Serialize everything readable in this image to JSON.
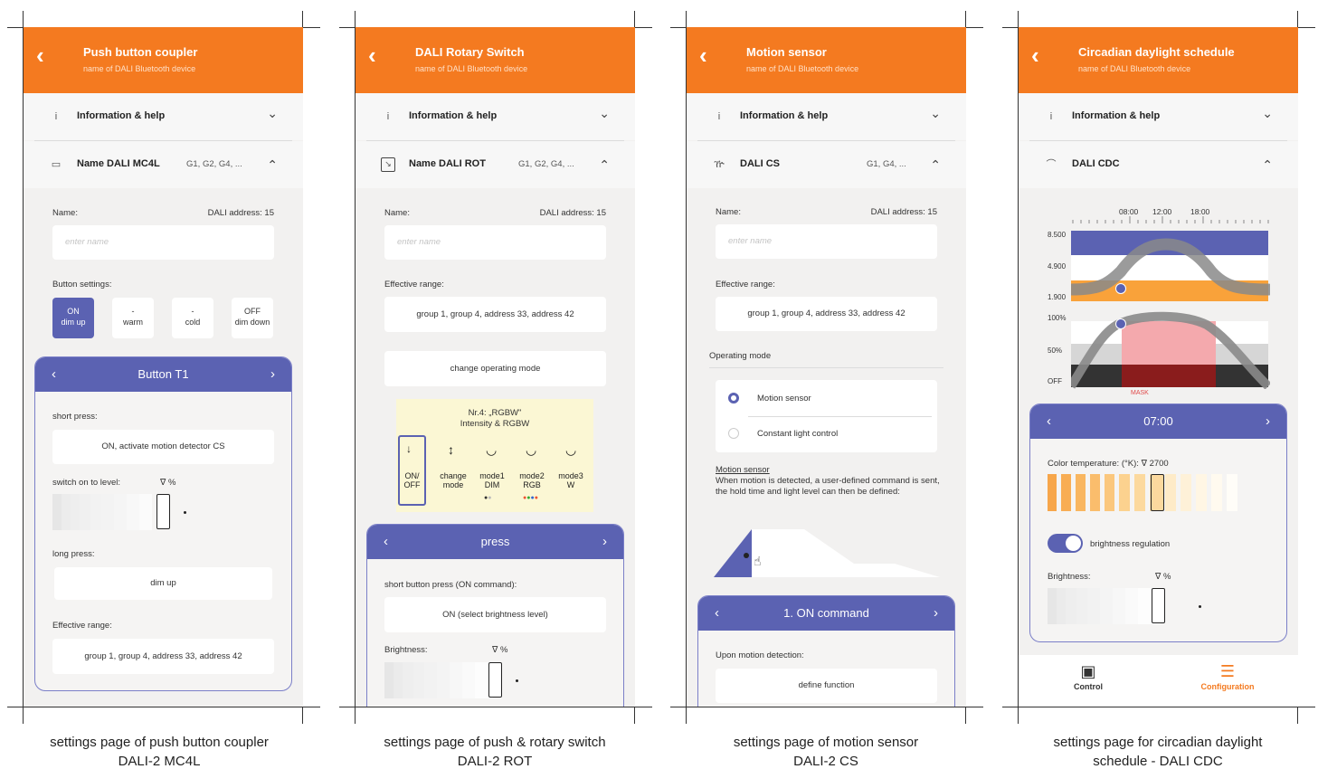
{
  "screens": [
    {
      "header": {
        "title": "Push button coupler",
        "subtitle": "name of DALI Bluetooth device"
      },
      "info": {
        "label": "Information & help"
      },
      "device": {
        "name": "Name DALI MC4L",
        "groups": "G1, G2, G4, ..."
      },
      "name_label": "Name:",
      "address": "DALI address: 15",
      "name_placeholder": "enter name",
      "button_settings_label": "Button settings:",
      "buttons": [
        {
          "top": "ON",
          "bottom": "dim up"
        },
        {
          "top": "-",
          "bottom": "warm"
        },
        {
          "top": "-",
          "bottom": "cold"
        },
        {
          "top": "OFF",
          "bottom": "dim down"
        }
      ],
      "panel_title": "Button T1",
      "short_press_label": "short press:",
      "short_press_value": "ON, activate motion detector CS",
      "switch_level_label": "switch on to level:",
      "switch_level_unit": "∇  %",
      "long_press_label": "long press:",
      "long_press_value": "dim up",
      "range_label": "Effective range:",
      "range_value": "group 1, group 4, address 33, address 42",
      "caption": "settings page of push button coupler\nDALI-2 MC4L"
    },
    {
      "header": {
        "title": "DALI Rotary Switch",
        "subtitle": "name of DALI Bluetooth device"
      },
      "info": {
        "label": "Information & help"
      },
      "device": {
        "name": "Name DALI ROT",
        "groups": "G1, G2, G4, ..."
      },
      "name_label": "Name:",
      "address": "DALI address: 15",
      "name_placeholder": "enter name",
      "range_label": "Effective range:",
      "range_value": "group 1, group 4, address 33, address 42",
      "change_mode": "change operating mode",
      "mode_box_title": "Nr.4: „RGBW\"\nIntensity & RGBW",
      "modes": [
        "ON/\nOFF",
        "change\nmode",
        "mode1\nDIM",
        "mode2\nRGB",
        "mode3\nW"
      ],
      "panel_title": "press",
      "short_btn_label": "short button press (ON command):",
      "short_btn_value": "ON (select brightness level)",
      "brightness_label": "Brightness:",
      "brightness_unit": "∇  %",
      "caption": "settings page of push & rotary switch\nDALI-2 ROT"
    },
    {
      "header": {
        "title": "Motion sensor",
        "subtitle": "name of DALI Bluetooth device"
      },
      "info": {
        "label": "Information & help"
      },
      "device": {
        "name": "DALI CS",
        "groups": "G1, G4, ..."
      },
      "name_label": "Name:",
      "address": "DALI address: 15",
      "name_placeholder": "enter name",
      "range_label": "Effective range:",
      "range_value": "group 1, group 4, address 33, address 42",
      "mode_label": "Operating mode",
      "options": [
        "Motion sensor",
        "Constant light control"
      ],
      "motion_title": "Motion sensor",
      "motion_text": "When motion is detected, a user-defined command is sent, the hold time and light level can then be defined:",
      "panel_title": "1. ON command",
      "upon_label": "Upon motion detection:",
      "define_value": "define function",
      "caption": "settings page of motion sensor\nDALI-2 CS"
    },
    {
      "header": {
        "title": "Circadian daylight schedule",
        "subtitle": "name of DALI Bluetooth device"
      },
      "info": {
        "label": "Information & help"
      },
      "device": {
        "name": "DALI CDC"
      },
      "times": [
        "08:00",
        "12:00",
        "18:00"
      ],
      "kelvin_labels": [
        "8.500",
        "4.900",
        "1.900"
      ],
      "level_labels": [
        "100%",
        "50%",
        "OFF"
      ],
      "mask_label": "MASK",
      "panel_title": "07:00",
      "color_temp_label": "Color temperature: (°K):  ∇  2700",
      "toggle_label": "brightness regulation",
      "brightness_label": "Brightness:",
      "brightness_unit": "∇  %",
      "nav": [
        "Control",
        "Configuration"
      ],
      "colors": {
        "accent": "#f47a20",
        "panel": "#5b62b2"
      },
      "caption": "settings page for circadian daylight\nschedule - DALI CDC"
    }
  ]
}
